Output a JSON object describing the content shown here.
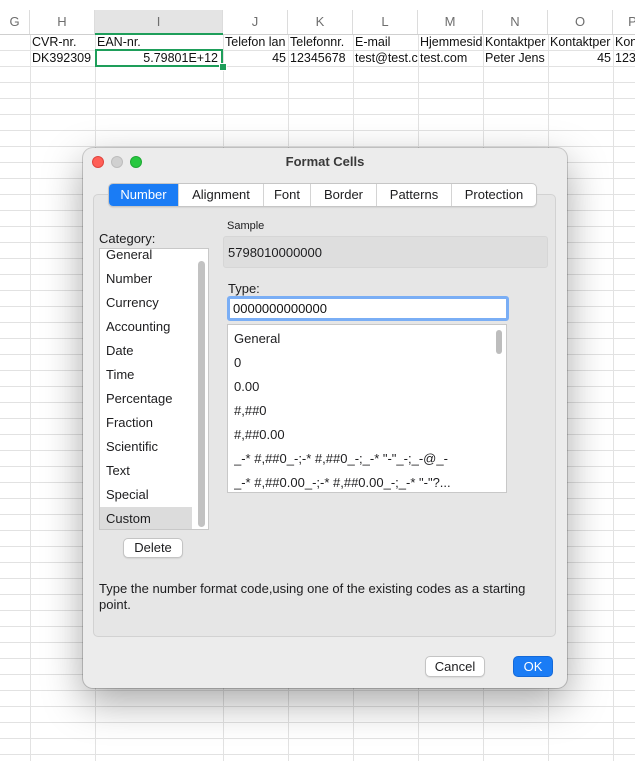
{
  "sheet": {
    "columns": [
      "G",
      "H",
      "I",
      "J",
      "K",
      "L",
      "M",
      "N",
      "O",
      "P"
    ],
    "row1": [
      "",
      "CVR-nr.",
      "EAN-nr.",
      "Telefon lan",
      "Telefonnr.",
      "E-mail",
      "Hjemmesid",
      "Kontaktper",
      "Kontaktper",
      "Kon"
    ],
    "row2": [
      "",
      "DK392309",
      "5.79801E+12",
      "45",
      "12345678",
      "test@test.c",
      "test.com",
      "Peter Jens",
      "45",
      "123"
    ],
    "active_cell_color": "#1e9e5a"
  },
  "dialog": {
    "title": "Format Cells",
    "tabs": [
      "Number",
      "Alignment",
      "Font",
      "Border",
      "Patterns",
      "Protection"
    ],
    "active_tab": "Number",
    "category_label": "Category:",
    "categories": [
      "General",
      "Number",
      "Currency",
      "Accounting",
      "Date",
      "Time",
      "Percentage",
      "Fraction",
      "Scientific",
      "Text",
      "Special",
      "Custom"
    ],
    "selected_category": "Custom",
    "delete_label": "Delete",
    "sample_label": "Sample",
    "sample_value": "5798010000000",
    "type_label": "Type:",
    "type_value": "0000000000000",
    "formats": [
      "General",
      "0",
      "0.00",
      "#,##0",
      "#,##0.00",
      "_-* #,##0_-;-* #,##0_-;_-* \"-\"_-;_-@_-",
      "_-* #,##0.00_-;-* #,##0.00_-;_-* \"-\"?..."
    ],
    "description": "Type the number format code,using one of the existing codes as a starting point.",
    "cancel_label": "Cancel",
    "ok_label": "OK",
    "accent_color": "#1a7cf5"
  }
}
